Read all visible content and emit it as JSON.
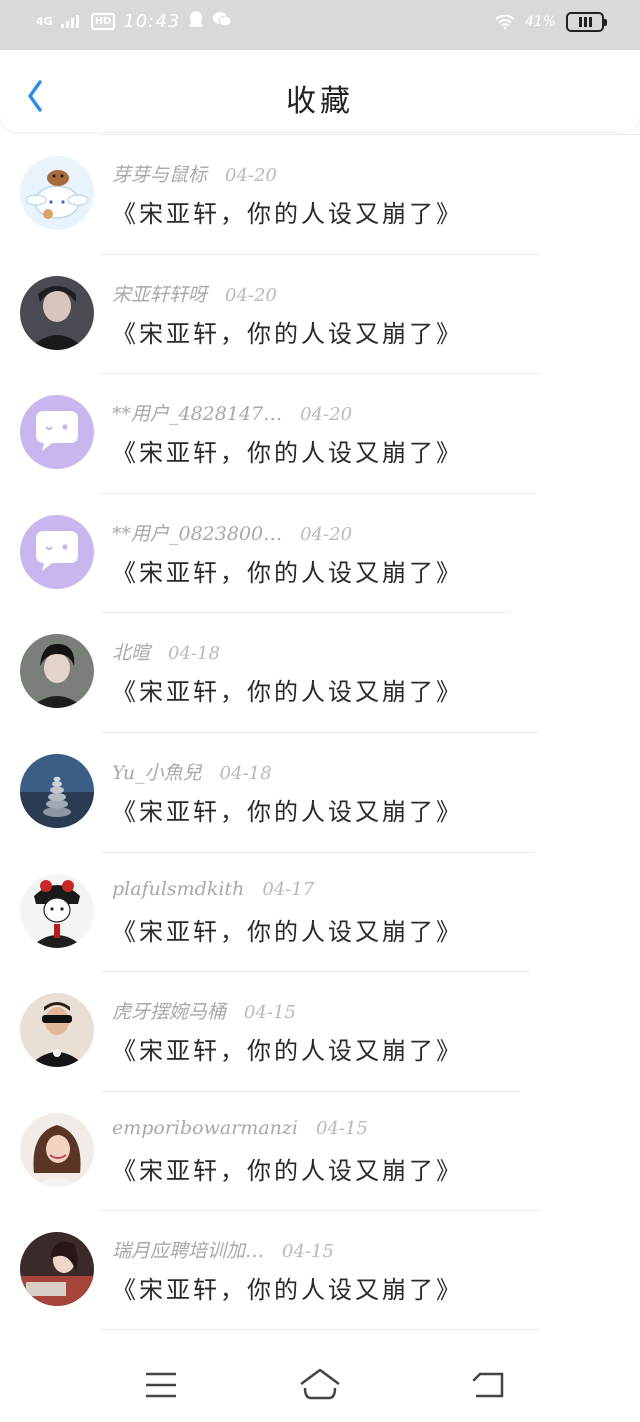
{
  "status_bar": {
    "network": "4G",
    "hd": "HD",
    "time": "10:43",
    "battery_percent": "41%",
    "icons": [
      "signal-icon",
      "qq-icon",
      "wechat-icon",
      "wifi-icon",
      "battery-icon"
    ]
  },
  "header": {
    "title": "收藏",
    "back_icon": "chevron-left-icon",
    "accent_color": "#2e8fe0"
  },
  "items": [
    {
      "user": "芽芽与鼠标",
      "date": "04-20",
      "title": "《宋亚轩，你的人设又崩了》",
      "avatar": "cinnamoroll-avatar"
    },
    {
      "user": "宋亚轩轩呀",
      "date": "04-20",
      "title": "《宋亚轩，你的人设又崩了》",
      "avatar": "photo-avatar"
    },
    {
      "user": "**用户_4828147…",
      "date": "04-20",
      "title": "《宋亚轩，你的人设又崩了》",
      "avatar": "default-chat-avatar"
    },
    {
      "user": "**用户_0823800…",
      "date": "04-20",
      "title": "《宋亚轩，你的人设又崩了》",
      "avatar": "default-chat-avatar"
    },
    {
      "user": "北暄",
      "date": "04-18",
      "title": "《宋亚轩，你的人设又崩了》",
      "avatar": "photo-avatar"
    },
    {
      "user": "Yu_小魚兒",
      "date": "04-18",
      "title": "《宋亚轩，你的人设又崩了》",
      "avatar": "stones-avatar"
    },
    {
      "user": "plafulsmdkith",
      "date": "04-17",
      "title": "《宋亚轩，你的人设又崩了》",
      "avatar": "anime-avatar"
    },
    {
      "user": "虎牙摆婉马桶",
      "date": "04-15",
      "title": "《宋亚轩，你的人设又崩了》",
      "avatar": "photo-avatar"
    },
    {
      "user": "emporibowarmanzi",
      "date": "04-15",
      "title": "《宋亚轩，你的人设又崩了》",
      "avatar": "photo-avatar"
    },
    {
      "user": "瑞月应聘培训加…",
      "date": "04-15",
      "title": "《宋亚轩，你的人设又崩了》",
      "avatar": "photo-avatar"
    }
  ],
  "nav": {
    "icons": [
      "menu-icon",
      "home-icon",
      "back-icon"
    ]
  }
}
